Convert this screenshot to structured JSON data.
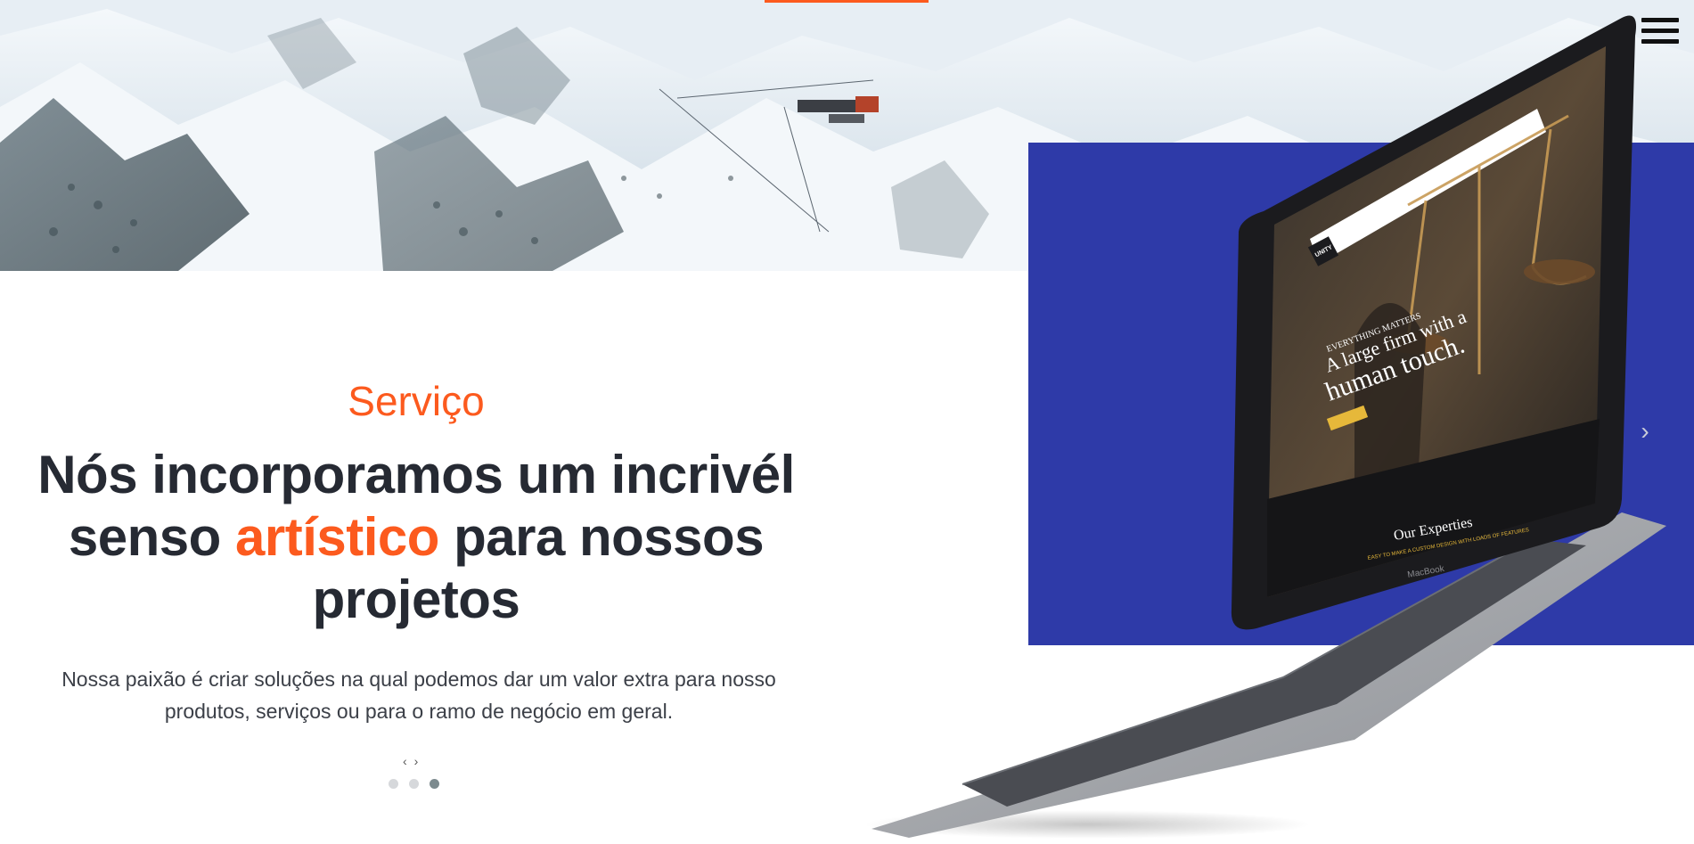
{
  "hero": {
    "eyebrow": "Serviço",
    "headline_part1": "Nós incorporamos um incrivél senso ",
    "headline_accent": "artístico",
    "headline_part2": " para nossos projetos",
    "description": "Nossa paixão é criar soluções na qual podemos dar um valor extra para nosso produtos, serviços ou para o ramo de negócio em geral."
  },
  "carousel": {
    "prev_symbol": "‹",
    "next_symbol": "›",
    "dots": 3,
    "active_dot": 3,
    "side_next_symbol": "›"
  },
  "laptop_screen": {
    "brand": "UNITY",
    "eyebrow": "EVERYTHING MATTERS",
    "title_line1": "A large firm with a",
    "title_line2": "human touch.",
    "section_title": "Our Experties",
    "section_subtitle": "EASY TO MAKE A CUSTOM DESIGN WITH LOADS OF FEATURES",
    "device_label": "MacBook"
  },
  "colors": {
    "accent": "#fc5a1e",
    "blue_block": "#2e3aa8",
    "text_dark": "#262a33"
  },
  "icons": {
    "menu": "hamburger-icon",
    "next": "chevron-right-icon"
  }
}
